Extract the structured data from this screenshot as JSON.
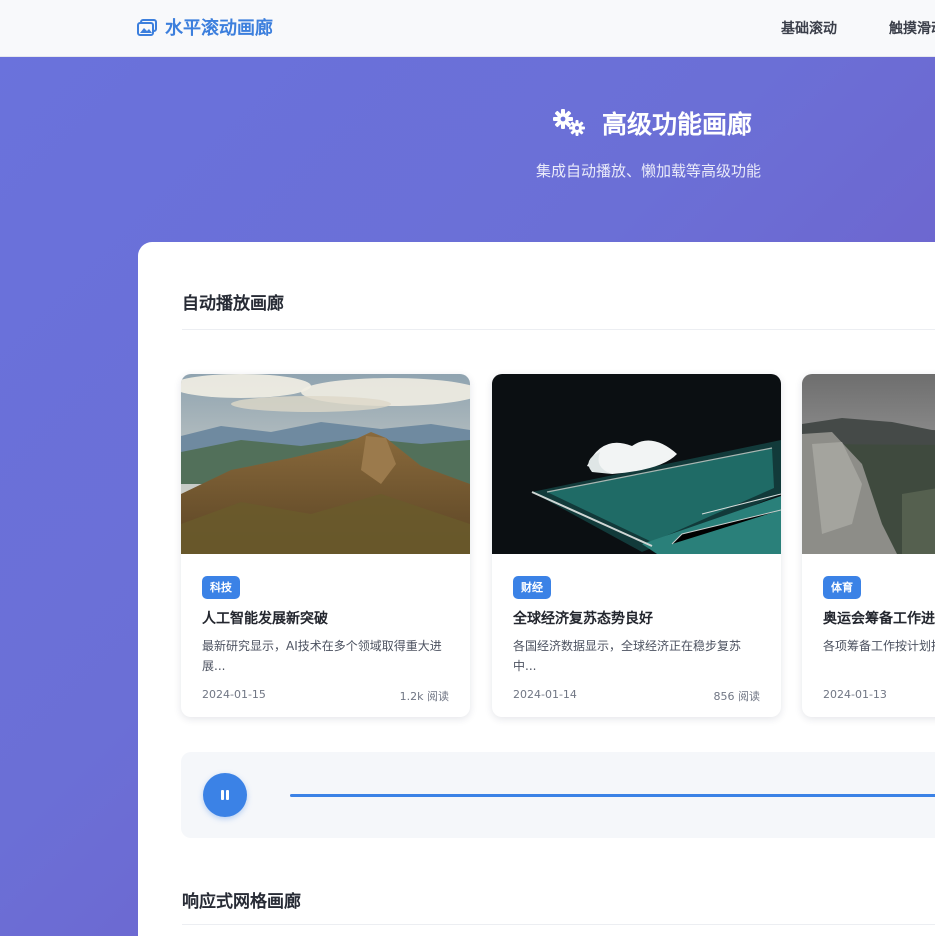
{
  "navbar": {
    "brand": "水平滚动画廊",
    "brand_icon": "images-icon",
    "links": [
      "基础滚动",
      "触摸滑动"
    ]
  },
  "hero": {
    "icon": "cogs-icon",
    "title": "高级功能画廊",
    "subtitle": "集成自动播放、懒加载等高级功能"
  },
  "autoplay_section": {
    "title": "自动播放画廊",
    "cards": [
      {
        "tag": "科技",
        "title": "人工智能发展新突破",
        "desc": "最新研究显示，AI技术在多个领域取得重大进展...",
        "date": "2024-01-15",
        "reads": "1.2k 阅读"
      },
      {
        "tag": "财经",
        "title": "全球经济复苏态势良好",
        "desc": "各国经济数据显示，全球经济正在稳步复苏中...",
        "date": "2024-01-14",
        "reads": "856 阅读"
      },
      {
        "tag": "体育",
        "title": "奥运会筹备工作进展",
        "desc": "各项筹备工作按计划推进工...",
        "date": "2024-01-13",
        "reads": ""
      }
    ],
    "controls": {
      "play_icon": "pause-icon",
      "progress": 1.0
    }
  },
  "grid_section": {
    "title": "响应式网格画廊"
  },
  "colors": {
    "accent": "#3b82e6",
    "brand": "#3c7fdd",
    "gradient_start": "#6a72dc",
    "gradient_end": "#7257c3"
  }
}
